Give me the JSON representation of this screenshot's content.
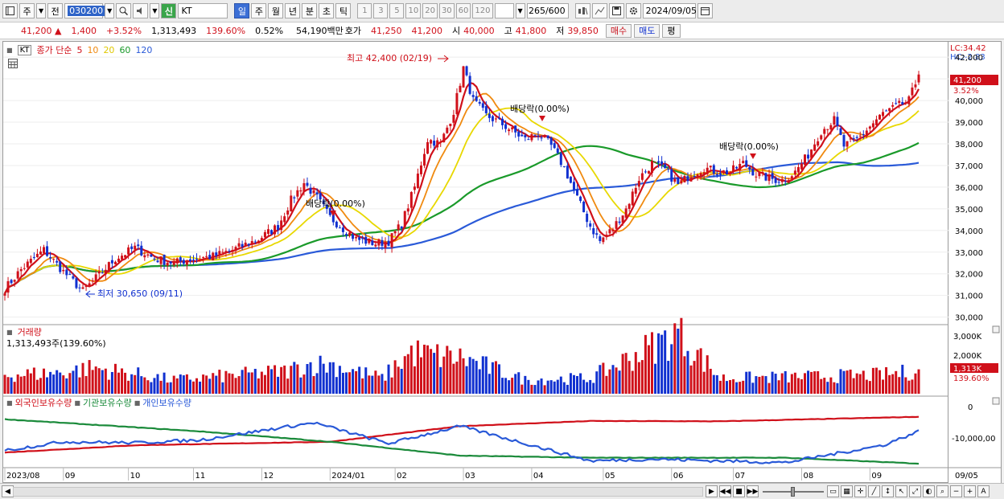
{
  "toolbar": {
    "period_btn": "주",
    "prev_btn": "전",
    "stock_code": "030200",
    "shin_label": "신",
    "stock_name": "KT",
    "periods": [
      "일",
      "주",
      "월",
      "년",
      "분",
      "초",
      "틱"
    ],
    "active_period": "일",
    "ticks": [
      "1",
      "3",
      "5",
      "10",
      "20",
      "30",
      "60",
      "120"
    ],
    "count": "265",
    "count_total": "/600",
    "date": "2024/09/05"
  },
  "quote": {
    "price": "41,200",
    "arrow": "▲",
    "change": "1,400",
    "change_pct": "+3.52%",
    "volume": "1,313,493",
    "volume_ratio": "139.60%",
    "turnover": "0.52%",
    "amount": "54,190백만",
    "bid_label": "호가",
    "bid1": "41,250",
    "bid2": "41,200",
    "open_label": "시",
    "open": "40,000",
    "high_label": "고",
    "high": "41,800",
    "low_label": "저",
    "low": "39,850",
    "buy_btn": "매수",
    "sell_btn": "매도",
    "eval_btn": "평"
  },
  "price_panel": {
    "ticker_box": "KT",
    "legend_prefix": "종가 단순",
    "ma_labels": [
      "5",
      "10",
      "20",
      "60",
      "120"
    ],
    "ma_colors": [
      "#d0101a",
      "#f08a10",
      "#e8d800",
      "#1a9a2a",
      "#2a5ad8"
    ],
    "annotation_high": "최고 42,400 (02/19)",
    "annotation_low": "최저 30,650 (09/11)",
    "dividend_labels": [
      "배당락(0.00%)",
      "배당락(0.00%)",
      "배당락(0.00%)"
    ],
    "lc": "LC:34.42",
    "hc": "HC:-2.83",
    "price_tag": "41,200",
    "price_tag_pct": "3.52%",
    "y_ticks": [
      "42,000",
      "41,000",
      "40,000",
      "39,000",
      "38,000",
      "37,000",
      "36,000",
      "35,000",
      "34,000",
      "33,000",
      "32,000",
      "31,000",
      "30,000"
    ]
  },
  "volume_panel": {
    "title": "거래량",
    "value": "1,313,493주(139.60%)",
    "y_ticks": [
      "3,000K",
      "2,000K",
      "1,000K"
    ],
    "tag": "1,313K",
    "tag_pct": "139.60%"
  },
  "holder_panel": {
    "legends": [
      "외국인보유수량",
      "기관보유수량",
      "개인보유수량"
    ],
    "legend_colors": [
      "#d0101a",
      "#1a8a3a",
      "#2a5ad8"
    ],
    "y_ticks": [
      "0",
      "-10,000,00"
    ]
  },
  "x_axis": {
    "labels": [
      "2023/08",
      "09",
      "10",
      "11",
      "12",
      "2024/01",
      "02",
      "03",
      "04",
      "05",
      "06",
      "07",
      "08",
      "09"
    ],
    "right_label": "09/05"
  },
  "chart_data": {
    "type": "candlestick",
    "title": "KT",
    "ylim": [
      29800,
      42600
    ],
    "x_label_positions_days": [
      0,
      18,
      38,
      58,
      79,
      100,
      120,
      141,
      162,
      184,
      205,
      224,
      245,
      266
    ],
    "close_keypoints": [
      [
        0,
        31300
      ],
      [
        5,
        32200
      ],
      [
        12,
        33100
      ],
      [
        18,
        32100
      ],
      [
        24,
        31200
      ],
      [
        28,
        31800
      ],
      [
        34,
        32700
      ],
      [
        40,
        33200
      ],
      [
        46,
        32700
      ],
      [
        52,
        32500
      ],
      [
        58,
        32700
      ],
      [
        64,
        32800
      ],
      [
        70,
        33100
      ],
      [
        78,
        33600
      ],
      [
        84,
        34200
      ],
      [
        88,
        35400
      ],
      [
        92,
        36200
      ],
      [
        96,
        35500
      ],
      [
        100,
        34600
      ],
      [
        104,
        34100
      ],
      [
        108,
        33600
      ],
      [
        114,
        33400
      ],
      [
        118,
        33500
      ],
      [
        122,
        34300
      ],
      [
        126,
        36000
      ],
      [
        130,
        38200
      ],
      [
        134,
        38000
      ],
      [
        138,
        39500
      ],
      [
        141,
        41500
      ],
      [
        144,
        40000
      ],
      [
        148,
        39300
      ],
      [
        152,
        39000
      ],
      [
        156,
        38600
      ],
      [
        160,
        38200
      ],
      [
        164,
        38500
      ],
      [
        168,
        37900
      ],
      [
        172,
        36900
      ],
      [
        176,
        35500
      ],
      [
        180,
        34200
      ],
      [
        183,
        33500
      ],
      [
        187,
        34100
      ],
      [
        191,
        35000
      ],
      [
        195,
        36400
      ],
      [
        199,
        37100
      ],
      [
        203,
        36800
      ],
      [
        207,
        36100
      ],
      [
        211,
        36600
      ],
      [
        215,
        36900
      ],
      [
        219,
        36700
      ],
      [
        223,
        36700
      ],
      [
        227,
        37100
      ],
      [
        231,
        36600
      ],
      [
        235,
        36400
      ],
      [
        239,
        36300
      ],
      [
        243,
        36700
      ],
      [
        247,
        37500
      ],
      [
        251,
        38600
      ],
      [
        255,
        39100
      ],
      [
        258,
        37900
      ],
      [
        262,
        38200
      ],
      [
        266,
        38800
      ],
      [
        270,
        39400
      ],
      [
        274,
        39700
      ],
      [
        278,
        40000
      ],
      [
        281,
        41200
      ]
    ],
    "moving_average_periods": [
      5,
      10,
      20,
      60,
      120
    ],
    "volume_keypoints": [
      [
        0,
        1100
      ],
      [
        16,
        1200
      ],
      [
        27,
        1500
      ],
      [
        52,
        800
      ],
      [
        86,
        1300
      ],
      [
        94,
        1700
      ],
      [
        100,
        1700
      ],
      [
        116,
        900
      ],
      [
        125,
        2400
      ],
      [
        133,
        2200
      ],
      [
        140,
        2100
      ],
      [
        160,
        800
      ],
      [
        180,
        900
      ],
      [
        207,
        3500
      ],
      [
        220,
        900
      ],
      [
        252,
        1000
      ],
      [
        270,
        1100
      ],
      [
        281,
        1313
      ]
    ],
    "volume_ylim": [
      0,
      3500
    ],
    "foreign_holdings_keypoints": [
      [
        0,
        -14600
      ],
      [
        40,
        -12500
      ],
      [
        100,
        -11500
      ],
      [
        140,
        -7000
      ],
      [
        180,
        -5500
      ],
      [
        220,
        -5600
      ],
      [
        281,
        -4300
      ]
    ],
    "institution_holdings_keypoints": [
      [
        0,
        -5000
      ],
      [
        60,
        -8500
      ],
      [
        100,
        -11500
      ],
      [
        140,
        -15500
      ],
      [
        180,
        -16100
      ],
      [
        240,
        -16100
      ],
      [
        281,
        -17800
      ]
    ],
    "individual_holdings_keypoints": [
      [
        0,
        -14000
      ],
      [
        18,
        -11500
      ],
      [
        40,
        -11800
      ],
      [
        60,
        -11000
      ],
      [
        95,
        -6000
      ],
      [
        118,
        -12000
      ],
      [
        140,
        -7000
      ],
      [
        180,
        -17000
      ],
      [
        200,
        -16500
      ],
      [
        240,
        -17500
      ],
      [
        270,
        -12500
      ],
      [
        281,
        -8500
      ]
    ],
    "holdings_ylim": [
      -18500,
      500
    ],
    "series": [
      {
        "name": "종가 단순 5"
      },
      {
        "name": "종가 단순 10"
      },
      {
        "name": "종가 단순 20"
      },
      {
        "name": "종가 단순 60"
      },
      {
        "name": "종가 단순 120"
      },
      {
        "name": "거래량"
      },
      {
        "name": "외국인보유수량"
      },
      {
        "name": "기관보유수량"
      },
      {
        "name": "개인보유수량"
      }
    ]
  }
}
